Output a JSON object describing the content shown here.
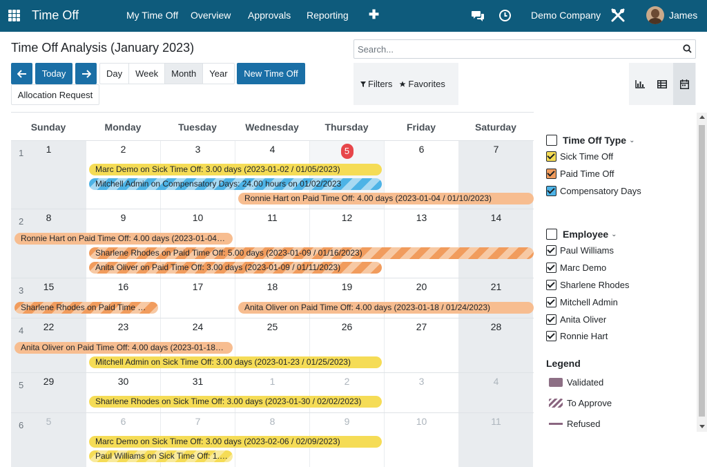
{
  "topnav": {
    "app_title": "Time Off",
    "menu": [
      "My Time Off",
      "Overview",
      "Approvals",
      "Reporting"
    ],
    "plus": "✚",
    "company": "Demo Company",
    "user": "James"
  },
  "control": {
    "title": "Time Off Analysis (January 2023)",
    "search_placeholder": "Search...",
    "today_label": "Today",
    "views": [
      "Day",
      "Week",
      "Month",
      "Year"
    ],
    "active_view": "Month",
    "new_label": "New Time Off",
    "allocation_label": "Allocation Request",
    "filters_label": "Filters",
    "favorites_label": "Favorites"
  },
  "calendar": {
    "days_of_week": [
      "Sunday",
      "Monday",
      "Tuesday",
      "Wednesday",
      "Thursday",
      "Friday",
      "Saturday"
    ],
    "weeks": [
      {
        "num": "1",
        "days": [
          "1",
          "2",
          "3",
          "4",
          "5",
          "6",
          "7"
        ],
        "muted": []
      },
      {
        "num": "2",
        "days": [
          "8",
          "9",
          "10",
          "11",
          "12",
          "13",
          "14"
        ],
        "muted": []
      },
      {
        "num": "3",
        "days": [
          "15",
          "16",
          "17",
          "18",
          "19",
          "20",
          "21"
        ],
        "muted": []
      },
      {
        "num": "4",
        "days": [
          "22",
          "23",
          "24",
          "25",
          "26",
          "27",
          "28"
        ],
        "muted": []
      },
      {
        "num": "5",
        "days": [
          "29",
          "30",
          "31",
          "1",
          "2",
          "3",
          "4"
        ],
        "muted": [
          3,
          4,
          5,
          6
        ]
      },
      {
        "num": "6",
        "days": [
          "5",
          "6",
          "7",
          "8",
          "9",
          "10",
          "11"
        ],
        "muted": [
          0,
          1,
          2,
          3,
          4,
          5,
          6
        ]
      }
    ],
    "today": "5",
    "events": [
      {
        "text": "Marc Demo on Sick Time Off: 3.00 days (2023-01-02 / 01/05/2023)",
        "type": "sick"
      },
      {
        "text": "Mitchell Admin on Compensatory Days: 24.00 hours on 01/02/2023",
        "type": "comp-stripe"
      },
      {
        "text": "Ronnie Hart on Paid Time Off: 4.00 days (2023-01-04 / 01/10/2023)",
        "type": "paid"
      },
      {
        "text": "Ronnie Hart on Paid Time Off: 4.00 days (2023-01-04…",
        "type": "paid"
      },
      {
        "text": "Sharlene Rhodes on Paid Time Off: 5.00 days (2023-01-09 / 01/16/2023)",
        "type": "paid-stripe"
      },
      {
        "text": "Anita Oliver on Paid Time Off: 3.00 days (2023-01-09 / 01/11/2023)",
        "type": "paid-stripe"
      },
      {
        "text": "Sharlene Rhodes on Paid Time …",
        "type": "paid-stripe"
      },
      {
        "text": "Anita Oliver on Paid Time Off: 4.00 days (2023-01-18 / 01/24/2023)",
        "type": "paid"
      },
      {
        "text": "Anita Oliver on Paid Time Off: 4.00 days (2023-01-18…",
        "type": "paid"
      },
      {
        "text": "Mitchell Admin on Sick Time Off: 3.00 days (2023-01-23 / 01/25/2023)",
        "type": "sick"
      },
      {
        "text": "Sharlene Rhodes on Sick Time Off: 3.00 days (2023-01-30 / 02/02/2023)",
        "type": "sick"
      },
      {
        "text": "Marc Demo on Sick Time Off: 3.00 days (2023-02-06 / 02/09/2023)",
        "type": "sick"
      },
      {
        "text": "Paul Williams on Sick Time Off: 1.…",
        "type": "sick-stripe"
      }
    ]
  },
  "sidebar": {
    "type_header": "Time Off Type",
    "types": [
      {
        "label": "Sick Time Off",
        "color": "#f5dc56"
      },
      {
        "label": "Paid Time Off",
        "color": "#f19c5d"
      },
      {
        "label": "Compensatory Days",
        "color": "#4db3e6"
      }
    ],
    "employee_header": "Employee",
    "employees": [
      "Paul Williams",
      "Marc Demo",
      "Sharlene Rhodes",
      "Mitchell Admin",
      "Anita Oliver",
      "Ronnie Hart"
    ],
    "legend_title": "Legend",
    "legend": [
      "Validated",
      "To Approve",
      "Refused"
    ]
  },
  "colors": {
    "navbar": "#0e5b7c",
    "primary": "#1a6fa6",
    "today": "#e7464a"
  }
}
